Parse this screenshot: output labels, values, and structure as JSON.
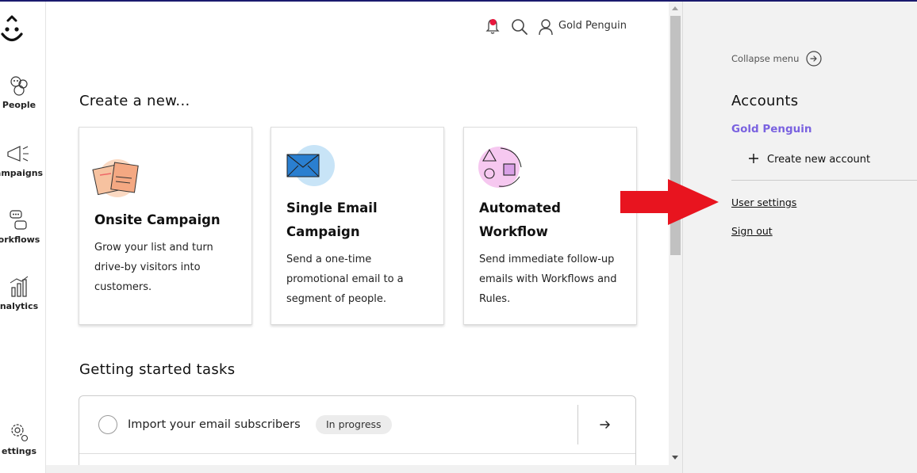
{
  "nav": {
    "items": [
      {
        "label": "People",
        "icon": "people-icon"
      },
      {
        "label": "ampaigns",
        "icon": "megaphone-icon"
      },
      {
        "label": "orkflows",
        "icon": "workflows-icon"
      },
      {
        "label": "nalytics",
        "icon": "analytics-icon"
      },
      {
        "label": "ettings",
        "icon": "settings-icon"
      }
    ]
  },
  "topbar": {
    "user_name": "Gold Penguin",
    "notification_color": "#e8163c"
  },
  "create": {
    "heading": "Create a new...",
    "cards": [
      {
        "title_lines": [
          "Onsite Campaign"
        ],
        "desc_lines": [
          "Grow your list and turn",
          "drive-by visitors into",
          "customers."
        ],
        "icon": "onsite-campaign-icon"
      },
      {
        "title_lines": [
          "Single Email",
          "Campaign"
        ],
        "desc_lines": [
          "Send a one-time",
          "promotional email to a",
          "segment of people."
        ],
        "icon": "email-envelope-icon"
      },
      {
        "title_lines": [
          "Automated",
          "Workflow"
        ],
        "desc_lines": [
          "Send immediate follow-up",
          "emails with Workflows and",
          "Rules."
        ],
        "icon": "workflow-shapes-icon"
      }
    ]
  },
  "tasks": {
    "heading": "Getting started tasks",
    "items": [
      {
        "label": "Import your email subscribers",
        "status": "In progress"
      }
    ]
  },
  "panel": {
    "collapse_label": "Collapse menu",
    "accounts_title": "Accounts",
    "account_name": "Gold Penguin",
    "account_color": "#7a62e0",
    "create_account": "Create new account",
    "user_settings": "User settings",
    "sign_out": "Sign out"
  },
  "annotation": {
    "arrow_color": "#e8141f"
  }
}
